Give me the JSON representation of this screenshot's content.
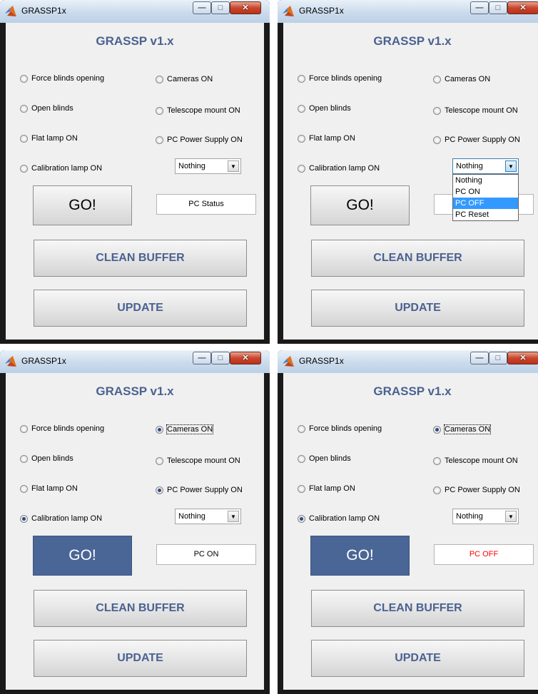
{
  "windows": [
    {
      "window_title": "GRASSP1x",
      "app_title": "GRASSP v1.x",
      "radios_left": [
        {
          "label": "Force blinds opening",
          "checked": false
        },
        {
          "label": "Open blinds",
          "checked": false
        },
        {
          "label": "Flat lamp ON",
          "checked": false
        },
        {
          "label": "Calibration lamp ON",
          "checked": false
        }
      ],
      "radios_right": [
        {
          "label": "Cameras ON",
          "checked": false
        },
        {
          "label": "Telescope mount ON",
          "checked": false
        },
        {
          "label": "PC Power Supply ON",
          "checked": false
        }
      ],
      "select_value": "Nothing",
      "dropdown_open": false,
      "go_label": "GO!",
      "go_pressed": false,
      "status_text": "PC Status",
      "status_color": "#000000",
      "clean_label": "CLEAN BUFFER",
      "update_label": "UPDATE"
    },
    {
      "window_title": "GRASSP1x",
      "app_title": "GRASSP v1.x",
      "radios_left": [
        {
          "label": "Force blinds opening",
          "checked": false
        },
        {
          "label": "Open blinds",
          "checked": false
        },
        {
          "label": "Flat lamp ON",
          "checked": false
        },
        {
          "label": "Calibration lamp ON",
          "checked": false
        }
      ],
      "radios_right": [
        {
          "label": "Cameras ON",
          "checked": false
        },
        {
          "label": "Telescope mount ON",
          "checked": false
        },
        {
          "label": "PC Power Supply ON",
          "checked": false
        }
      ],
      "select_value": "Nothing",
      "dropdown_open": true,
      "dropdown_options": [
        "Nothing",
        "PC ON",
        "PC OFF",
        "PC Reset"
      ],
      "dropdown_highlight": "PC OFF",
      "go_label": "GO!",
      "go_pressed": false,
      "status_text": "",
      "status_color": "#000000",
      "clean_label": "CLEAN BUFFER",
      "update_label": "UPDATE"
    },
    {
      "window_title": "GRASSP1x",
      "app_title": "GRASSP v1.x",
      "radios_left": [
        {
          "label": "Force blinds opening",
          "checked": false
        },
        {
          "label": "Open blinds",
          "checked": false
        },
        {
          "label": "Flat lamp ON",
          "checked": false
        },
        {
          "label": "Calibration lamp ON",
          "checked": true
        }
      ],
      "radios_right": [
        {
          "label": "Cameras ON",
          "checked": true,
          "focused": true
        },
        {
          "label": "Telescope mount ON",
          "checked": false
        },
        {
          "label": "PC Power Supply ON",
          "checked": true
        }
      ],
      "select_value": "Nothing",
      "dropdown_open": false,
      "go_label": "GO!",
      "go_pressed": true,
      "status_text": "PC ON",
      "status_color": "#000000",
      "clean_label": "CLEAN BUFFER",
      "update_label": "UPDATE"
    },
    {
      "window_title": "GRASSP1x",
      "app_title": "GRASSP v1.x",
      "radios_left": [
        {
          "label": "Force blinds opening",
          "checked": false
        },
        {
          "label": "Open blinds",
          "checked": false
        },
        {
          "label": "Flat lamp ON",
          "checked": false
        },
        {
          "label": "Calibration lamp ON",
          "checked": true
        }
      ],
      "radios_right": [
        {
          "label": "Cameras ON",
          "checked": true,
          "focused": true
        },
        {
          "label": "Telescope mount ON",
          "checked": false
        },
        {
          "label": "PC Power Supply ON",
          "checked": false
        }
      ],
      "select_value": "Nothing",
      "dropdown_open": false,
      "go_label": "GO!",
      "go_pressed": true,
      "status_text": "PC OFF",
      "status_color": "#ff0000",
      "clean_label": "CLEAN BUFFER",
      "update_label": "UPDATE"
    }
  ]
}
